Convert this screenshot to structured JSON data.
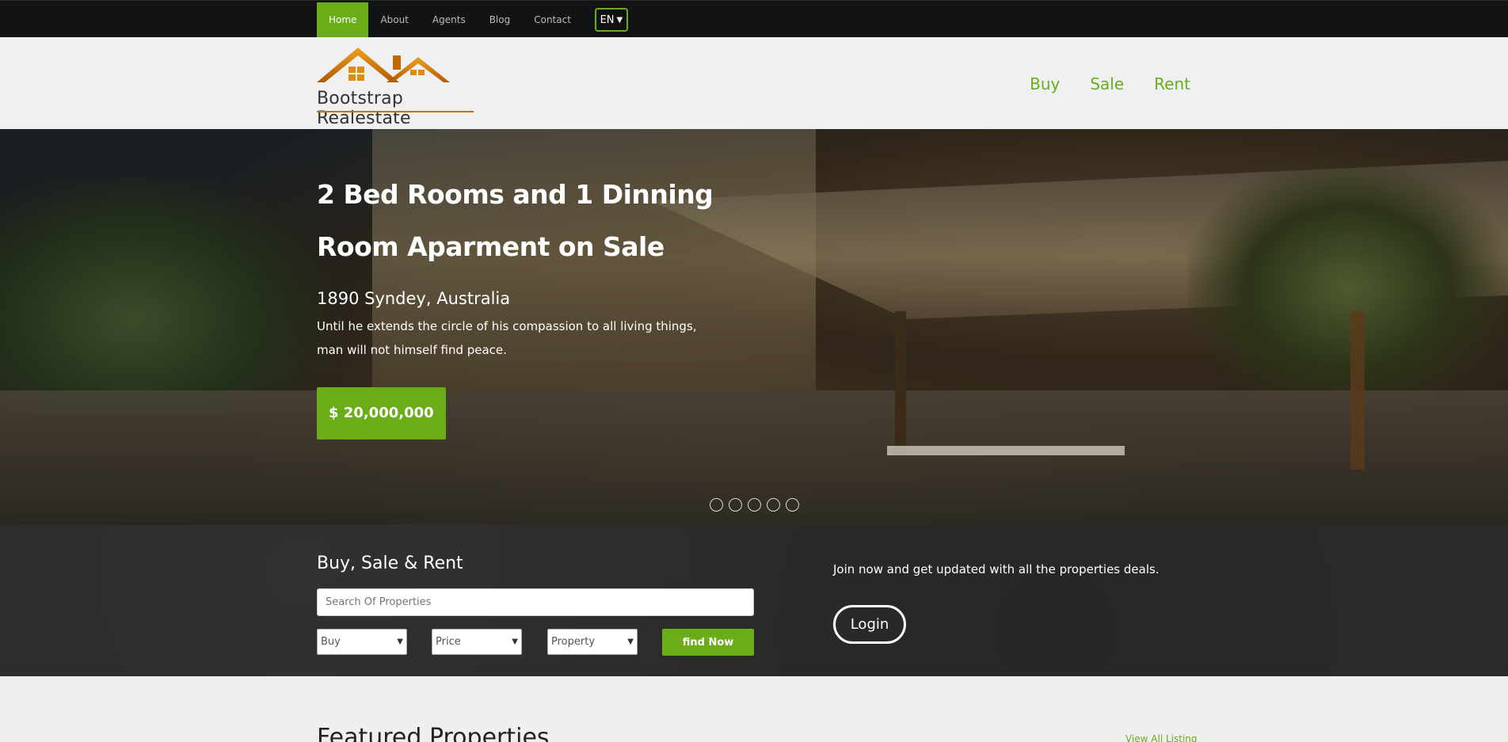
{
  "topnav": {
    "items": [
      {
        "label": "Home",
        "active": true
      },
      {
        "label": "About",
        "active": false
      },
      {
        "label": "Agents",
        "active": false
      },
      {
        "label": "Blog",
        "active": false
      },
      {
        "label": "Contact",
        "active": false
      }
    ],
    "language": "EN"
  },
  "header": {
    "logo_text": "Bootstrap Realestate",
    "nav": [
      "Buy",
      "Sale",
      "Rent"
    ]
  },
  "hero": {
    "title_line1": "2 Bed Rooms and 1 Dinning",
    "title_line2": "Room Aparment on Sale",
    "location": "1890 Syndey, Australia",
    "description": "Until he extends the circle of his compassion to all living things, man will not himself find peace.",
    "price": "$ 20,000,000",
    "slide_count": 5
  },
  "search": {
    "title": "Buy, Sale & Rent",
    "placeholder": "Search Of Properties",
    "type_select": "Buy",
    "price_select": "Price",
    "property_select": "Property",
    "find_label": "find Now"
  },
  "join": {
    "text": "Join now and get updated with all the properties deals.",
    "login_label": "Login"
  },
  "featured": {
    "title": "Featured Properties",
    "view_all": "View All Listing"
  },
  "colors": {
    "accent": "#6aad18",
    "topbar": "#121314",
    "band": "#2a2b2b",
    "logo_roof": "#d87f00"
  }
}
